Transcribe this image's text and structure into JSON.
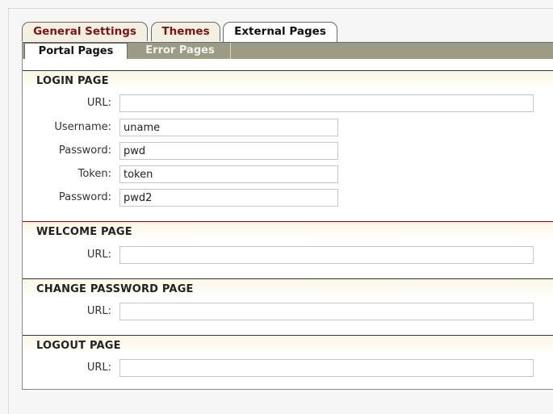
{
  "main_tabs": [
    {
      "label": "General Settings"
    },
    {
      "label": "Themes"
    },
    {
      "label": "External Pages"
    }
  ],
  "sub_tabs": [
    {
      "label": "Portal Pages"
    },
    {
      "label": "Error Pages"
    }
  ],
  "sections": {
    "login": {
      "title": "LOGIN PAGE",
      "url_label": "URL:",
      "url_value": "",
      "username_label": "Username:",
      "username_value": "uname",
      "password_label": "Password:",
      "password_value": "pwd",
      "token_label": "Token:",
      "token_value": "token",
      "password2_label": "Password:",
      "password2_value": "pwd2"
    },
    "welcome": {
      "title": "WELCOME PAGE",
      "url_label": "URL:",
      "url_value": ""
    },
    "change_password": {
      "title": "CHANGE PASSWORD PAGE",
      "url_label": "URL:",
      "url_value": ""
    },
    "logout": {
      "title": "LOGOUT PAGE",
      "url_label": "URL:",
      "url_value": ""
    }
  },
  "colors": {
    "tab_text": "#7a1515",
    "section_rule": "#7a1515",
    "subtab_bar": "#9c9c86"
  }
}
